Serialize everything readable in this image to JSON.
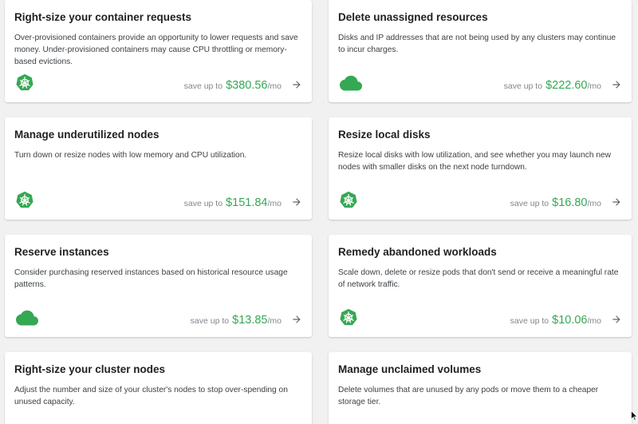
{
  "colors": {
    "accent_green": "#34a853",
    "muted_text": "#80868b",
    "background": "#f1f1f1"
  },
  "cards": [
    {
      "title": "Right-size your container requests",
      "description": "Over-provisioned containers provide an opportunity to lower requests and save money. Under-provisioned containers may cause CPU throttling or memory-based evictions.",
      "icon": "kubernetes-icon",
      "save_prefix": "save up to",
      "amount": "$380.56",
      "unit": "/mo"
    },
    {
      "title": "Delete unassigned resources",
      "description": "Disks and IP addresses that are not being used by any clusters may continue to incur charges.",
      "icon": "cloud-icon",
      "save_prefix": "save up to",
      "amount": "$222.60",
      "unit": "/mo"
    },
    {
      "title": "Manage underutilized nodes",
      "description": "Turn down or resize nodes with low memory and CPU utilization.",
      "icon": "kubernetes-icon",
      "save_prefix": "save up to",
      "amount": "$151.84",
      "unit": "/mo"
    },
    {
      "title": "Resize local disks",
      "description": "Resize local disks with low utilization, and see whether you may launch new nodes with smaller disks on the next node turndown.",
      "icon": "kubernetes-icon",
      "save_prefix": "save up to",
      "amount": "$16.80",
      "unit": "/mo"
    },
    {
      "title": "Reserve instances",
      "description": "Consider purchasing reserved instances based on historical resource usage patterns.",
      "icon": "cloud-icon",
      "save_prefix": "save up to",
      "amount": "$13.85",
      "unit": "/mo"
    },
    {
      "title": "Remedy abandoned workloads",
      "description": "Scale down, delete or resize pods that don't send or receive a meaningful rate of network traffic.",
      "icon": "kubernetes-icon",
      "save_prefix": "save up to",
      "amount": "$10.06",
      "unit": "/mo"
    },
    {
      "title": "Right-size your cluster nodes",
      "description": "Adjust the number and size of your cluster's nodes to stop over-spending on unused capacity."
    },
    {
      "title": "Manage unclaimed volumes",
      "description": "Delete volumes that are unused by any pods or move them to a cheaper storage tier."
    }
  ]
}
